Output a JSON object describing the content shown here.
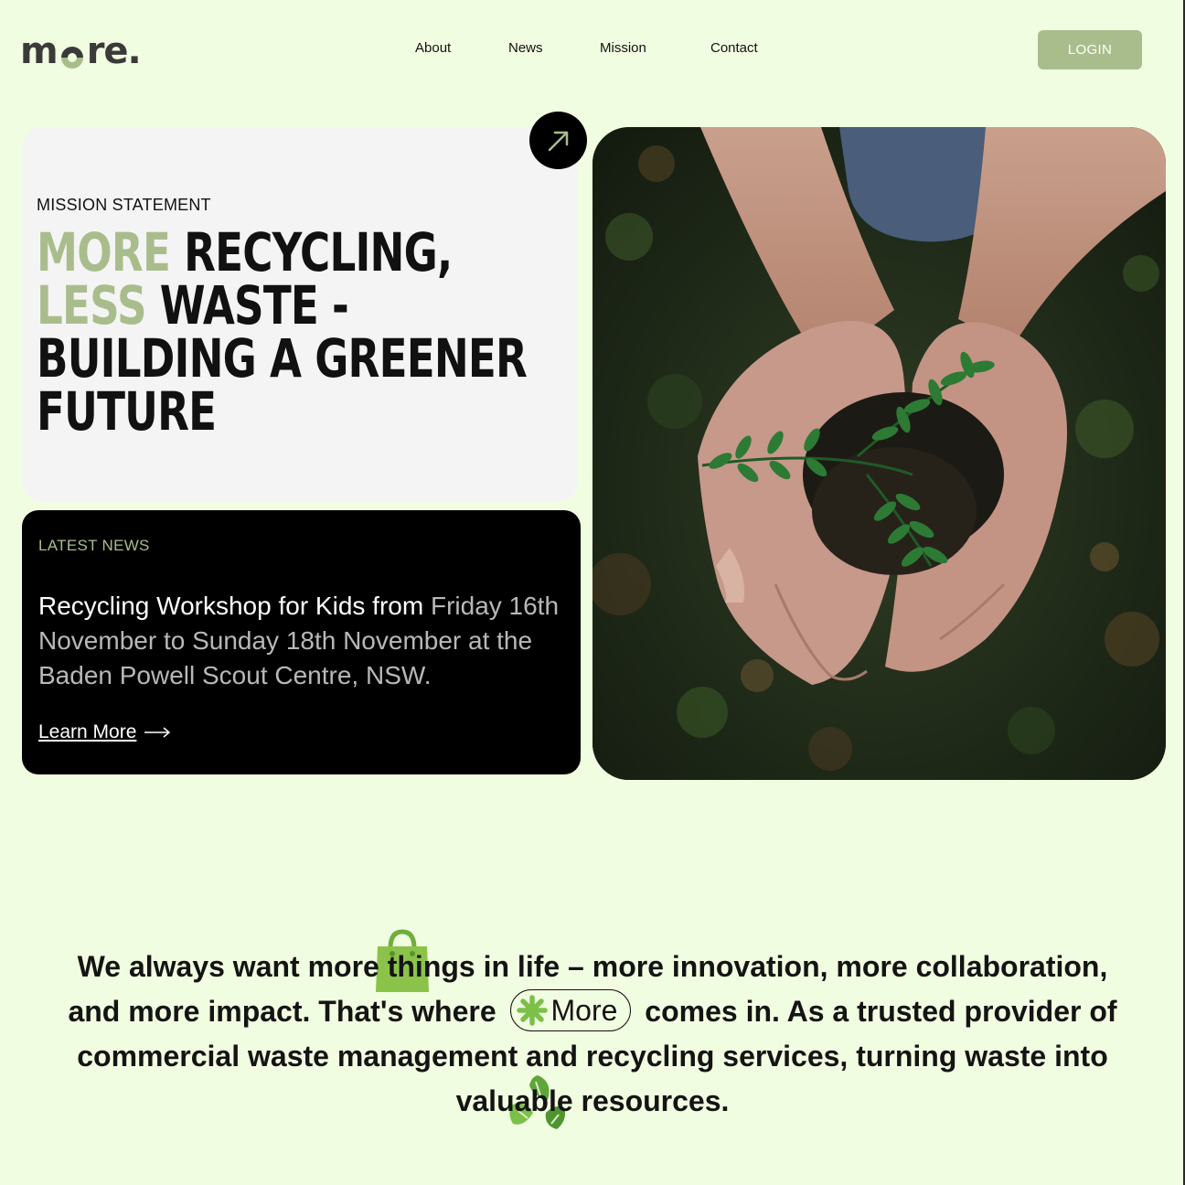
{
  "brand": {
    "logo_pre": "m",
    "logo_post": "re.",
    "accent": "#a9bd8c",
    "background": "#f1fde0"
  },
  "nav": {
    "items": [
      "About",
      "News",
      "Mission",
      "Contact"
    ],
    "login": "LOGIN"
  },
  "mission": {
    "label": "MISSION STATEMENT",
    "hl1": "MORE",
    "t1": " RECYCLING,",
    "hl2": "LESS",
    "t2": " WASTE -",
    "t3": "BUILDING A GREENER",
    "t4": "FUTURE",
    "arrow_icon": "arrow-up-right-icon"
  },
  "news": {
    "label": "LATEST NEWS",
    "headline": "Recycling Workshop for Kids from ",
    "details": "Friday 16th November to Sunday 18th November at the Baden Powell Scout Centre, NSW.",
    "link": "Learn More"
  },
  "about": {
    "p1": "We always want more things in life – more innovation, more collaboration, and more impact. That's where",
    "pill": "More",
    "p2": "comes in. As a trusted provider of commercial waste management and recycling services, turning waste into valuable resources."
  }
}
